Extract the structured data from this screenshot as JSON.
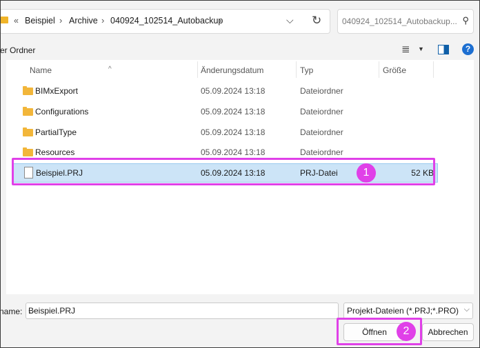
{
  "address": {
    "back_chevrons": "«",
    "crumbs": [
      "Beispiel",
      "Archive",
      "040924_102514_Autobackup"
    ],
    "separator": "›",
    "dropdown_icon": "chevron-down-icon",
    "refresh_icon": "refresh-icon"
  },
  "search": {
    "placeholder": "040924_102514_Autobackup...",
    "icon": "search-icon"
  },
  "toolbar": {
    "new_folder_label": "er Ordner",
    "view_icon": "view-list-icon",
    "pane_icon": "preview-pane-icon",
    "help_icon": "help-icon",
    "help_glyph": "?"
  },
  "columns": {
    "name": "Name",
    "date": "Änderungsdatum",
    "type": "Typ",
    "size": "Größe"
  },
  "files": [
    {
      "name": "BIMxExport",
      "date": "05.09.2024 13:18",
      "type": "Dateiordner",
      "size": "",
      "kind": "folder"
    },
    {
      "name": "Configurations",
      "date": "05.09.2024 13:18",
      "type": "Dateiordner",
      "size": "",
      "kind": "folder"
    },
    {
      "name": "PartialType",
      "date": "05.09.2024 13:18",
      "type": "Dateiordner",
      "size": "",
      "kind": "folder"
    },
    {
      "name": "Resources",
      "date": "05.09.2024 13:18",
      "type": "Dateiordner",
      "size": "",
      "kind": "folder"
    },
    {
      "name": "Beispiel.PRJ",
      "date": "05.09.2024 13:18",
      "type": "PRJ-Datei",
      "size": "52 KB",
      "kind": "file",
      "selected": true
    }
  ],
  "annotations": {
    "badge1": "1",
    "badge2": "2",
    "highlight_color": "#e040e8"
  },
  "bottom": {
    "filename_label": "name:",
    "filename_value": "Beispiel.PRJ",
    "filetype_value": "Projekt-Dateien (*.PRJ;*.PRO)",
    "open_label": "Öffnen",
    "cancel_label": "Abbrechen"
  }
}
